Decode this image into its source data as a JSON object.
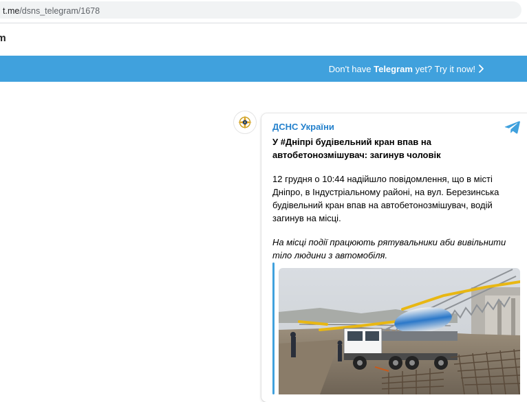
{
  "browser": {
    "url_host": "t.me",
    "url_path": "/dsns_telegram/1678"
  },
  "header": {
    "brand_fragment": "am"
  },
  "banner": {
    "text_before": "Don't have ",
    "text_bold": "Telegram",
    "text_after": " yet? Try it now!",
    "bg_color": "#40a1dd"
  },
  "post": {
    "author": "ДСНС України",
    "title": "У #Дніпрі будівельний кран впав на автобетонозмішувач: загинув чоловік",
    "body": "12 грудня о 10:44 надійшло повідомлення, що в місті Дніпро, в Індустріальному районі, на вул. Березинська будівельний кран впав на автобетонозмішувач, водій загинув на місці.",
    "italic": "На місці події працюють рятувальники аби вивільнити тіло людини з автомобіля.",
    "author_color": "#2481cc",
    "icons": [
      "dsns-emblem-icon",
      "telegram-logo-icon"
    ]
  }
}
